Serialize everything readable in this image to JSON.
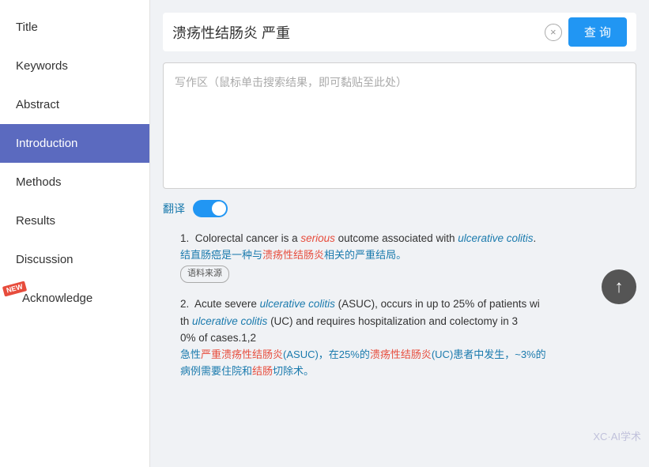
{
  "sidebar": {
    "items": [
      {
        "id": "title",
        "label": "Title",
        "active": false,
        "new": false
      },
      {
        "id": "keywords",
        "label": "Keywords",
        "active": false,
        "new": false
      },
      {
        "id": "abstract",
        "label": "Abstract",
        "active": false,
        "new": false
      },
      {
        "id": "introduction",
        "label": "Introduction",
        "active": true,
        "new": false
      },
      {
        "id": "methods",
        "label": "Methods",
        "active": false,
        "new": false
      },
      {
        "id": "results",
        "label": "Results",
        "active": false,
        "new": false
      },
      {
        "id": "discussion",
        "label": "Discussion",
        "active": false,
        "new": false
      },
      {
        "id": "acknowledge",
        "label": "Acknowledge",
        "active": false,
        "new": true
      }
    ]
  },
  "search": {
    "query": "溃疡性结肠炎 严重",
    "placeholder": "写作区（鼠标单击搜索结果，即可黏贴至此处）",
    "button_label": "查 询",
    "clear_title": "×"
  },
  "translate": {
    "label": "翻译",
    "enabled": true
  },
  "results": [
    {
      "number": "1.",
      "en_parts": [
        {
          "text": "Colorectal cancer is a ",
          "style": "normal"
        },
        {
          "text": "serious",
          "style": "red-italic"
        },
        {
          "text": " outcome associated with ",
          "style": "normal"
        },
        {
          "text": "ulcerative colitis",
          "style": "blue-italic"
        },
        {
          "text": ".",
          "style": "normal"
        }
      ],
      "zh": "结直肠癌是一种与溃疡性结肠炎相关的严重结局。",
      "zh_parts": [
        {
          "text": "结直肠癌是一种与",
          "style": "normal"
        },
        {
          "text": "溃疡性结肠炎",
          "style": "red"
        },
        {
          "text": "相关的",
          "style": "normal"
        },
        {
          "text": "严重",
          "style": "normal"
        },
        {
          "text": "结局。",
          "style": "normal"
        }
      ],
      "source_tag": "语料来源"
    },
    {
      "number": "2.",
      "en_parts": [
        {
          "text": "Acute severe ",
          "style": "normal"
        },
        {
          "text": "ulcerative colitis",
          "style": "blue-italic"
        },
        {
          "text": " (ASUC), occurs in up to 25% of patients wi th ",
          "style": "normal"
        },
        {
          "text": "ulcerative colitis",
          "style": "blue-italic"
        },
        {
          "text": " (UC) and requires hospitalization and colectomy in 3 0% of cases.1,2",
          "style": "normal"
        }
      ],
      "zh": "急性严重溃疡性结肠炎(ASUC)，在25%的溃疡性结肠炎(UC)患者中发生，~3%的病例需要住院和结肠切除术。",
      "zh_parts": [
        {
          "text": "急性",
          "style": "normal"
        },
        {
          "text": "严重溃疡性结肠炎",
          "style": "red"
        },
        {
          "text": "(ASUC)，在25%的",
          "style": "normal"
        },
        {
          "text": "溃疡性结肠炎",
          "style": "red"
        },
        {
          "text": "(UC)患者中发生，~3%的病例需要住院和",
          "style": "normal"
        },
        {
          "text": "结肠",
          "style": "red"
        },
        {
          "text": "切除术。",
          "style": "normal"
        }
      ],
      "source_tag": null
    }
  ],
  "watermark": "XC·AI学术",
  "scroll_up_label": "↑"
}
